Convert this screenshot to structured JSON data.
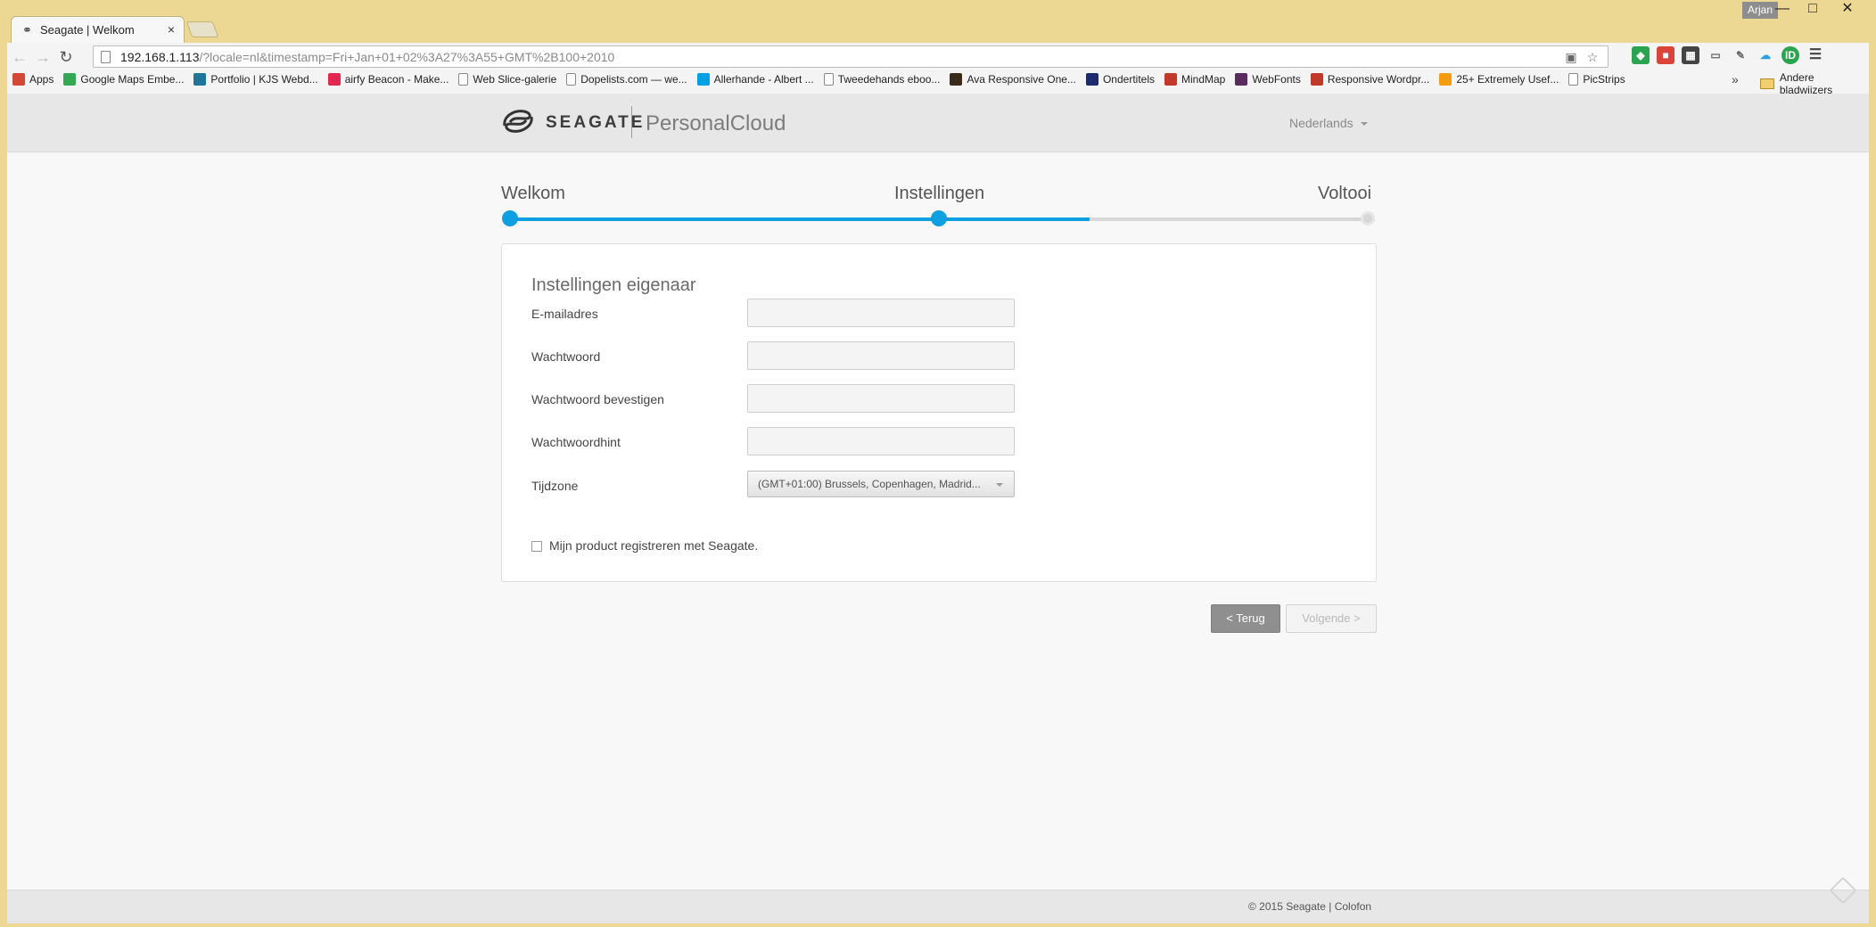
{
  "window": {
    "user": "Arjan",
    "controls": [
      "minimize",
      "maximize",
      "close"
    ]
  },
  "tab": {
    "title": "Seagate | Welkom",
    "close": "×"
  },
  "address_bar": {
    "host": "192.168.1.113",
    "path": "/?locale=nl&timestamp=Fri+Jan+01+02%3A27%3A55+GMT%2B100+2010"
  },
  "bookmarks": [
    {
      "label": "Apps",
      "icon": "apps-grid-icon",
      "color": "#d34836"
    },
    {
      "label": "Google Maps Embe...",
      "icon": "google-maps-icon",
      "color": "#34a853"
    },
    {
      "label": "Portfolio | KJS Webd...",
      "icon": "wordpress-icon",
      "color": "#21759b"
    },
    {
      "label": "airfy Beacon - Make...",
      "icon": "go-icon",
      "color": "#e2264d"
    },
    {
      "label": "Web Slice-galerie",
      "icon": "page-icon",
      "color": ""
    },
    {
      "label": "Dopelists.com — we...",
      "icon": "page-icon",
      "color": ""
    },
    {
      "label": "Allerhande - Albert ...",
      "icon": "albert-heijn-icon",
      "color": "#00a0e2"
    },
    {
      "label": "Tweedehands eboo...",
      "icon": "page-icon",
      "color": ""
    },
    {
      "label": "Ava Responsive One...",
      "icon": "ava-icon",
      "color": "#3a2a1a"
    },
    {
      "label": "Ondertitels",
      "icon": "ondertitels-icon",
      "color": "#1c2b6b"
    },
    {
      "label": "MindMap",
      "icon": "mindmap-icon",
      "color": "#c0392b"
    },
    {
      "label": "WebFonts",
      "icon": "webfonts-icon",
      "color": "#5b2a5e"
    },
    {
      "label": "Responsive Wordpr...",
      "icon": "responsive-wp-icon",
      "color": "#c0392b"
    },
    {
      "label": "25+ Extremely Usef...",
      "icon": "usef-icon",
      "color": "#f39c12"
    },
    {
      "label": "PicStrips",
      "icon": "page-icon",
      "color": ""
    }
  ],
  "bookmarks_overflow": "»",
  "bookmarks_other": "Andere bladwijzers",
  "header": {
    "brand": "SEAGATE",
    "product": "PersonalCloud",
    "language": "Nederlands"
  },
  "stepper": {
    "steps": [
      "Welkom",
      "Instellingen",
      "Voltooi"
    ],
    "progress": 0.67,
    "accent": "#0d9fe0"
  },
  "form": {
    "title": "Instellingen eigenaar",
    "fields": [
      {
        "label": "E-mailadres",
        "value": ""
      },
      {
        "label": "Wachtwoord",
        "value": ""
      },
      {
        "label": "Wachtwoord bevestigen",
        "value": ""
      },
      {
        "label": "Wachtwoordhint",
        "value": ""
      }
    ],
    "timezone_label": "Tijdzone",
    "timezone_value": "(GMT+01:00) Brussels, Copenhagen, Madrid...",
    "register_label": "Mijn product registreren met Seagate.",
    "register_checked": false
  },
  "buttons": {
    "back": "< Terug",
    "next": "Volgende >"
  },
  "footer": {
    "text": "© 2015 Seagate | Colofon"
  }
}
